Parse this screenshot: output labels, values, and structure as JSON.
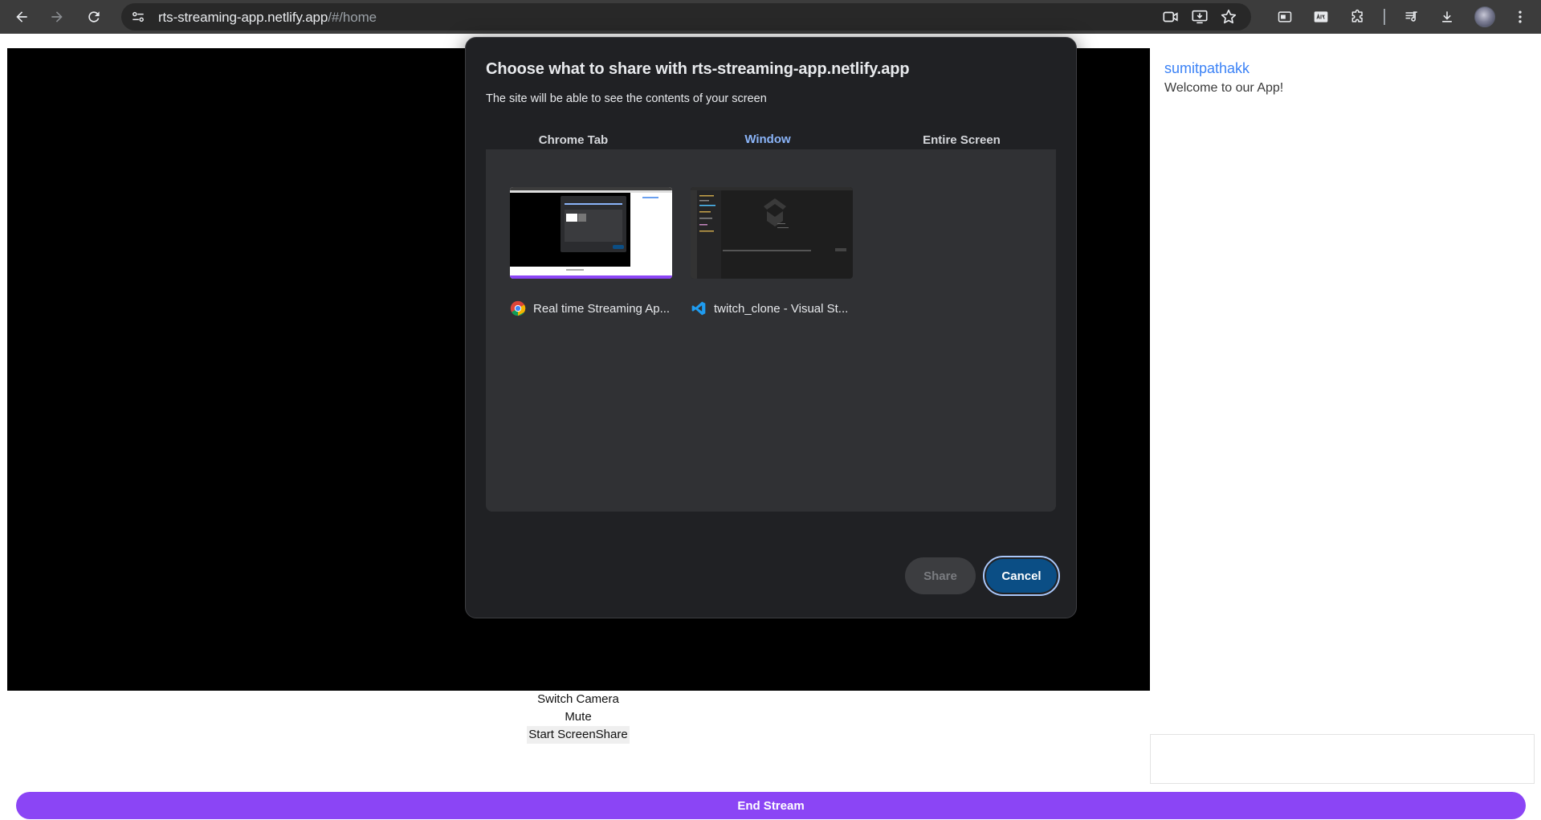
{
  "browser": {
    "url_host": "rts-streaming-app.netlify.app",
    "url_path": "/#/home",
    "icons": [
      "back-icon",
      "forward-icon",
      "reload-icon",
      "site-settings-icon",
      "camera-in-use-icon",
      "install-app-icon",
      "bookmark-star-icon",
      "side-panel-icon",
      "extension-ably-icon",
      "extensions-puzzle-icon",
      "media-controls-icon",
      "downloads-icon",
      "profile-avatar",
      "more-menu-icon"
    ]
  },
  "page": {
    "controls": {
      "switch_camera": "Switch Camera",
      "mute": "Mute",
      "start_screenshare": "Start ScreenShare"
    },
    "chat": {
      "username": "sumitpathakk",
      "message": "Welcome to our App!"
    },
    "end_stream": "End Stream",
    "colors": {
      "accent": "#8b45f5",
      "link": "#3b82f6"
    }
  },
  "dialog": {
    "title": "Choose what to share with rts-streaming-app.netlify.app",
    "subtitle": "The site will be able to see the contents of your screen",
    "tabs": [
      {
        "label": "Chrome Tab",
        "active": false
      },
      {
        "label": "Window",
        "active": true
      },
      {
        "label": "Entire Screen",
        "active": false
      }
    ],
    "windows": [
      {
        "label": "Real time Streaming Ap...",
        "icon": "chrome-icon"
      },
      {
        "label": "twitch_clone - Visual St...",
        "icon": "vscode-icon"
      }
    ],
    "share_label": "Share",
    "cancel_label": "Cancel",
    "colors": {
      "active_tab": "#8ab4f8",
      "cancel_bg": "#0b4e85"
    }
  }
}
